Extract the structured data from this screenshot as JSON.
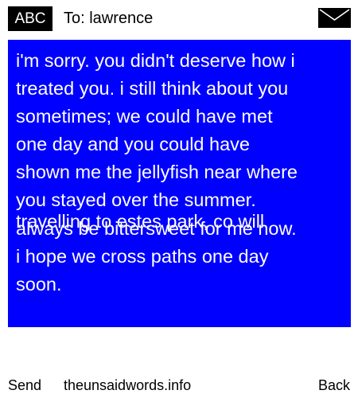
{
  "header": {
    "mode_label": "ABC",
    "recipient": "To: lawrence",
    "icon": "envelope-icon"
  },
  "message": {
    "lines": [
      "i'm sorry. you didn't deserve how i",
      "treated you. i still think about you",
      "sometimes; we could have met",
      "one day and you could have",
      "shown me the jellyfish near where",
      "you stayed over the summer.",
      "travelling to estes park, co will",
      "always be bittersweet for me now.",
      "i hope we cross paths one day",
      "soon."
    ]
  },
  "footer": {
    "send_label": "Send",
    "site": "theunsaidwords.info",
    "back_label": "Back"
  },
  "colors": {
    "message_background": "#0000fe",
    "message_text": "#ffffff",
    "header_badge": "#000000"
  }
}
